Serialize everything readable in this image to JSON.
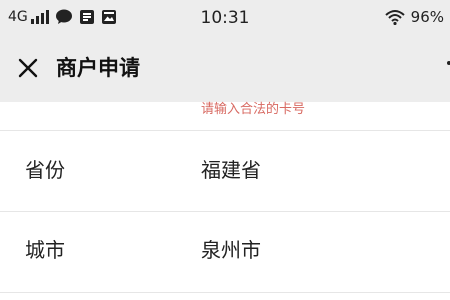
{
  "status_bar": {
    "network": "4G",
    "time": "10:31",
    "battery": "96%"
  },
  "navbar": {
    "title": "商户申请",
    "close_icon": "close-icon"
  },
  "form": {
    "card_error": "请输入合法的卡号",
    "rows": [
      {
        "label": "省份",
        "value": "福建省"
      },
      {
        "label": "城市",
        "value": "泉州市"
      }
    ]
  },
  "colors": {
    "header_bg": "#ededed",
    "error_text": "#d86a62",
    "divider": "#e6e6e6"
  }
}
